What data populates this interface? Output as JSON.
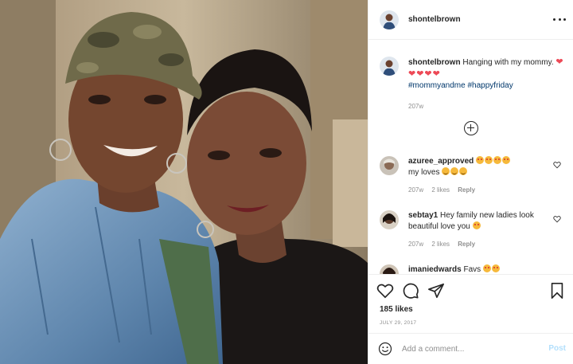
{
  "post": {
    "username": "shontelbrown",
    "caption": {
      "username": "shontelbrown",
      "text": "Hanging with my mommy.",
      "hearts": "❤❤❤❤❤",
      "tag1": "#mommyandme",
      "tag2": "#happyfriday",
      "time": "207w"
    },
    "comments": [
      {
        "username": "azuree_approved",
        "text": "my loves",
        "time": "207w",
        "likes": "2 likes",
        "reply": "Reply"
      },
      {
        "username": "sebtay1",
        "text": "Hey family new ladies look beautiful love you",
        "time": "207w",
        "likes": "2 likes",
        "reply": "Reply"
      },
      {
        "username": "imaniedwards",
        "text": "Favs"
      }
    ],
    "likes_count": "185 likes",
    "date": "JULY 29, 2017",
    "add_comment_placeholder": "Add a comment...",
    "post_button": "Post"
  },
  "icons": {
    "more": "more-options-icon",
    "load_more": "plus-circle-icon",
    "like": "heart-icon",
    "comment": "comment-icon",
    "share": "share-icon",
    "save": "bookmark-icon",
    "emoji": "smiley-icon"
  },
  "colors": {
    "link": "#00376b",
    "muted": "#8e8e8e",
    "heart": "#ed4956",
    "post_button": "#b2dffc"
  }
}
